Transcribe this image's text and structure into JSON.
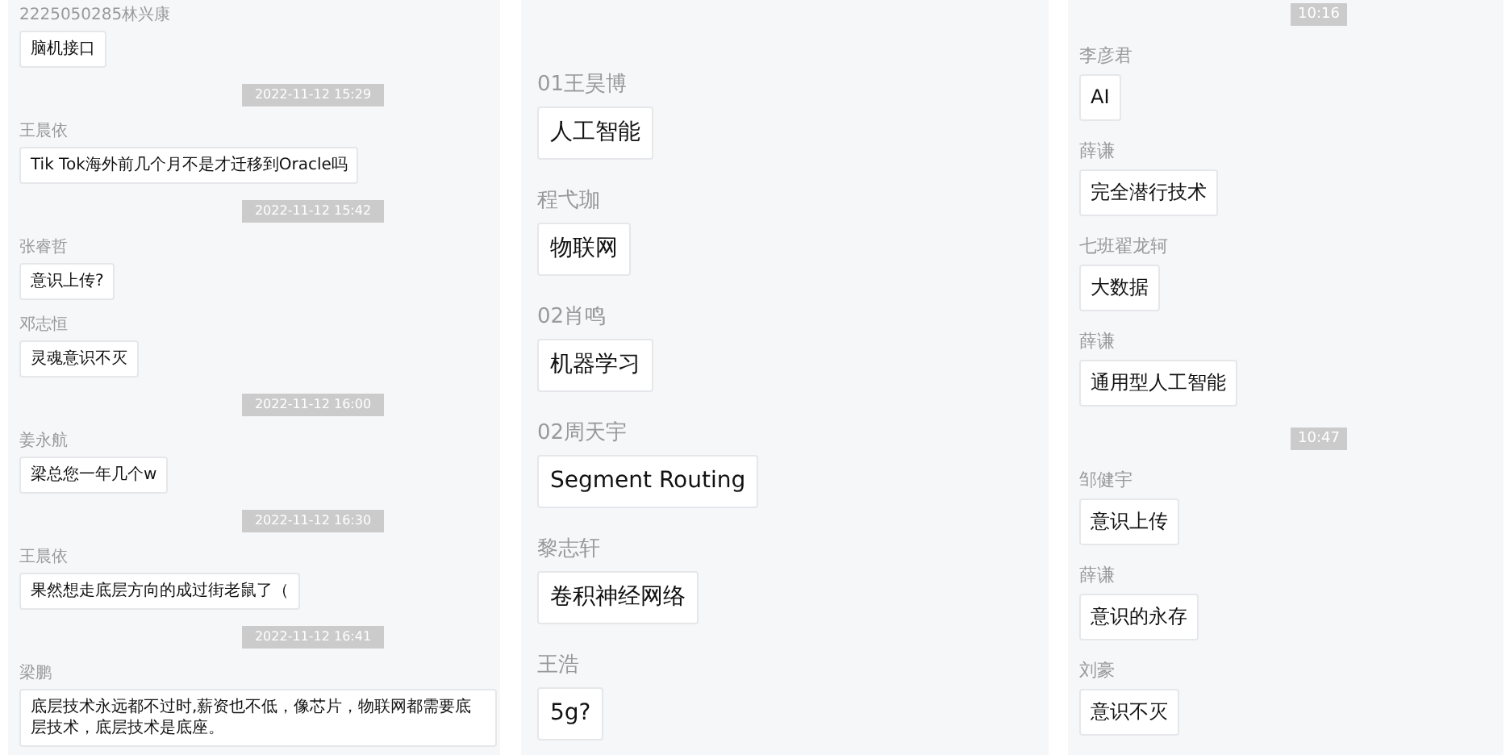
{
  "panels": [
    {
      "messages": [
        {
          "kind": "message",
          "sender": "2225050285林兴康",
          "text": "脑机接口"
        },
        {
          "kind": "timestamp",
          "text": "2022-11-12 15:29"
        },
        {
          "kind": "message",
          "sender": "王晨依",
          "text": "Tik Tok海外前几个月不是才迁移到Oracle吗"
        },
        {
          "kind": "timestamp",
          "text": "2022-11-12 15:42"
        },
        {
          "kind": "message",
          "sender": "张睿哲",
          "text": "意识上传?"
        },
        {
          "kind": "message",
          "sender": "邓志恒",
          "text": "灵魂意识不灭"
        },
        {
          "kind": "timestamp",
          "text": "2022-11-12 16:00"
        },
        {
          "kind": "message",
          "sender": "姜永航",
          "text": "梁总您一年几个w"
        },
        {
          "kind": "timestamp",
          "text": "2022-11-12 16:30"
        },
        {
          "kind": "message",
          "sender": "王晨依",
          "text": "果然想走底层方向的成过街老鼠了（"
        },
        {
          "kind": "timestamp",
          "text": "2022-11-12 16:41"
        },
        {
          "kind": "message",
          "sender": "梁鹏",
          "text": "底层技术永远都不过时,薪资也不低，像芯片，物联网都需要底层技术，底层技术是底座。"
        }
      ]
    },
    {
      "messages": [
        {
          "kind": "message",
          "sender": "01王昊博",
          "text": "人工智能"
        },
        {
          "kind": "message",
          "sender": "程弋珈",
          "text": "物联网"
        },
        {
          "kind": "message",
          "sender": "02肖鸣",
          "text": "机器学习"
        },
        {
          "kind": "message",
          "sender": "02周天宇",
          "text": "Segment Routing"
        },
        {
          "kind": "message",
          "sender": "黎志轩",
          "text": "卷积神经网络"
        },
        {
          "kind": "message",
          "sender": "王浩",
          "text": "5g?"
        }
      ]
    },
    {
      "messages": [
        {
          "kind": "timestamp",
          "text": "10:16"
        },
        {
          "kind": "message",
          "sender": "李彦君",
          "text": "AI"
        },
        {
          "kind": "message",
          "sender": "薛谦",
          "text": "完全潜行技术"
        },
        {
          "kind": "message",
          "sender": "七班翟龙轲",
          "text": "大数据"
        },
        {
          "kind": "message",
          "sender": "薛谦",
          "text": "通用型人工智能"
        },
        {
          "kind": "timestamp",
          "text": "10:47"
        },
        {
          "kind": "message",
          "sender": "邹健宇",
          "text": "意识上传"
        },
        {
          "kind": "message",
          "sender": "薛谦",
          "text": "意识的永存"
        },
        {
          "kind": "message",
          "sender": "刘豪",
          "text": "意识不灭"
        }
      ]
    }
  ]
}
